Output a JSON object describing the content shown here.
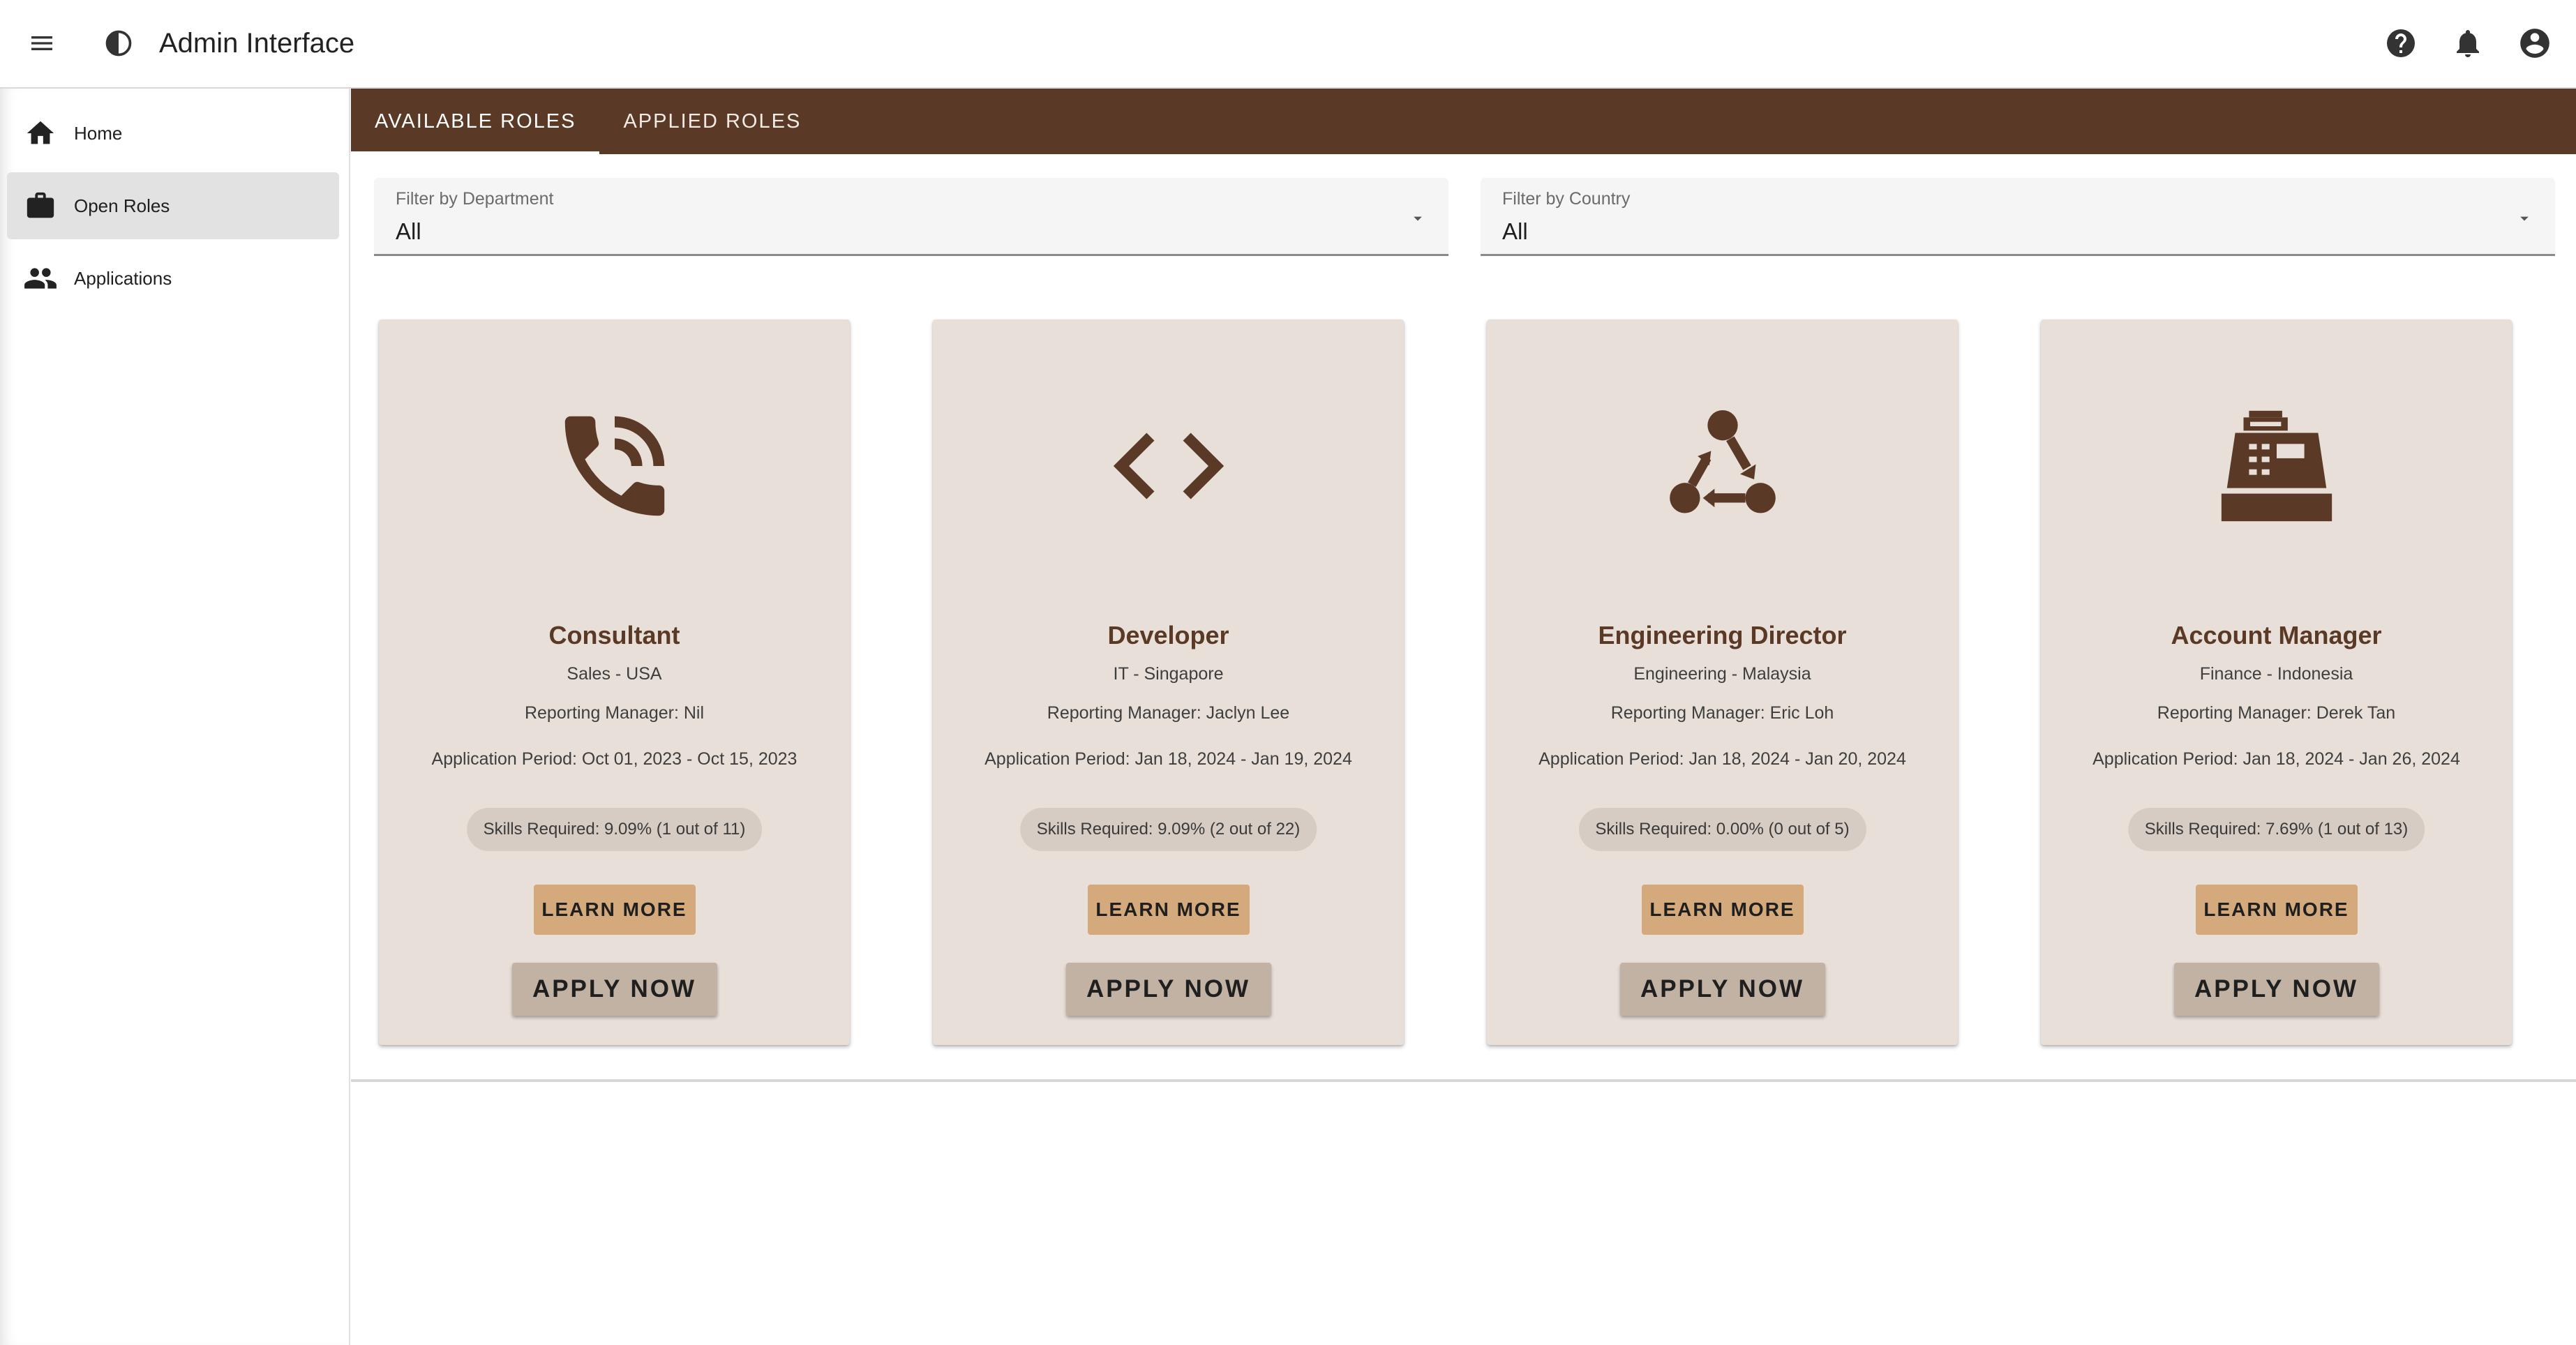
{
  "app": {
    "title": "Admin Interface",
    "menu_icon": "menu-icon",
    "theme_icon": "contrast-icon",
    "right_icons": [
      "help-icon",
      "notifications-icon",
      "account-circle-icon"
    ]
  },
  "sidebar": {
    "items": [
      {
        "label": "Home",
        "icon": "home-icon",
        "active": false
      },
      {
        "label": "Open Roles",
        "icon": "briefcase-icon",
        "active": true
      },
      {
        "label": "Applications",
        "icon": "people-icon",
        "active": false
      }
    ]
  },
  "tabs": [
    {
      "label": "AVAILABLE ROLES",
      "active": true
    },
    {
      "label": "APPLIED ROLES",
      "active": false
    }
  ],
  "filters": {
    "department": {
      "label": "Filter by Department",
      "value": "All"
    },
    "country": {
      "label": "Filter by Country",
      "value": "All"
    }
  },
  "colors": {
    "accent": "#5a3a26",
    "card_bg": "#e8e0d8",
    "learn_button": "#d4aa7c",
    "apply_button": "#c2b2a3",
    "chip_bg": "#d6ccc3"
  },
  "roles": [
    {
      "title": "Consultant",
      "icon": "phone-in-talk-icon",
      "dept_country": "Sales - USA",
      "manager": "Reporting Manager: Nil",
      "period": "Application Period: Oct 01, 2023 - Oct 15, 2023",
      "skills": "Skills Required: 9.09% (1 out of 11)",
      "learn_label": "LEARN MORE",
      "apply_label": "APPLY NOW"
    },
    {
      "title": "Developer",
      "icon": "code-icon",
      "dept_country": "IT - Singapore",
      "manager": "Reporting Manager: Jaclyn Lee",
      "period": "Application Period: Jan 18, 2024 - Jan 19, 2024",
      "skills": "Skills Required: 9.09% (2 out of 22)",
      "learn_label": "LEARN MORE",
      "apply_label": "APPLY NOW"
    },
    {
      "title": "Engineering Director",
      "icon": "workflow-icon",
      "dept_country": "Engineering - Malaysia",
      "manager": "Reporting Manager: Eric Loh",
      "period": "Application Period: Jan 18, 2024 - Jan 20, 2024",
      "skills": "Skills Required: 0.00% (0 out of 5)",
      "learn_label": "LEARN MORE",
      "apply_label": "APPLY NOW"
    },
    {
      "title": "Account Manager",
      "icon": "cash-register-icon",
      "dept_country": "Finance - Indonesia",
      "manager": "Reporting Manager: Derek Tan",
      "period": "Application Period: Jan 18, 2024 - Jan 26, 2024",
      "skills": "Skills Required: 7.69% (1 out of 13)",
      "learn_label": "LEARN MORE",
      "apply_label": "APPLY NOW"
    }
  ]
}
